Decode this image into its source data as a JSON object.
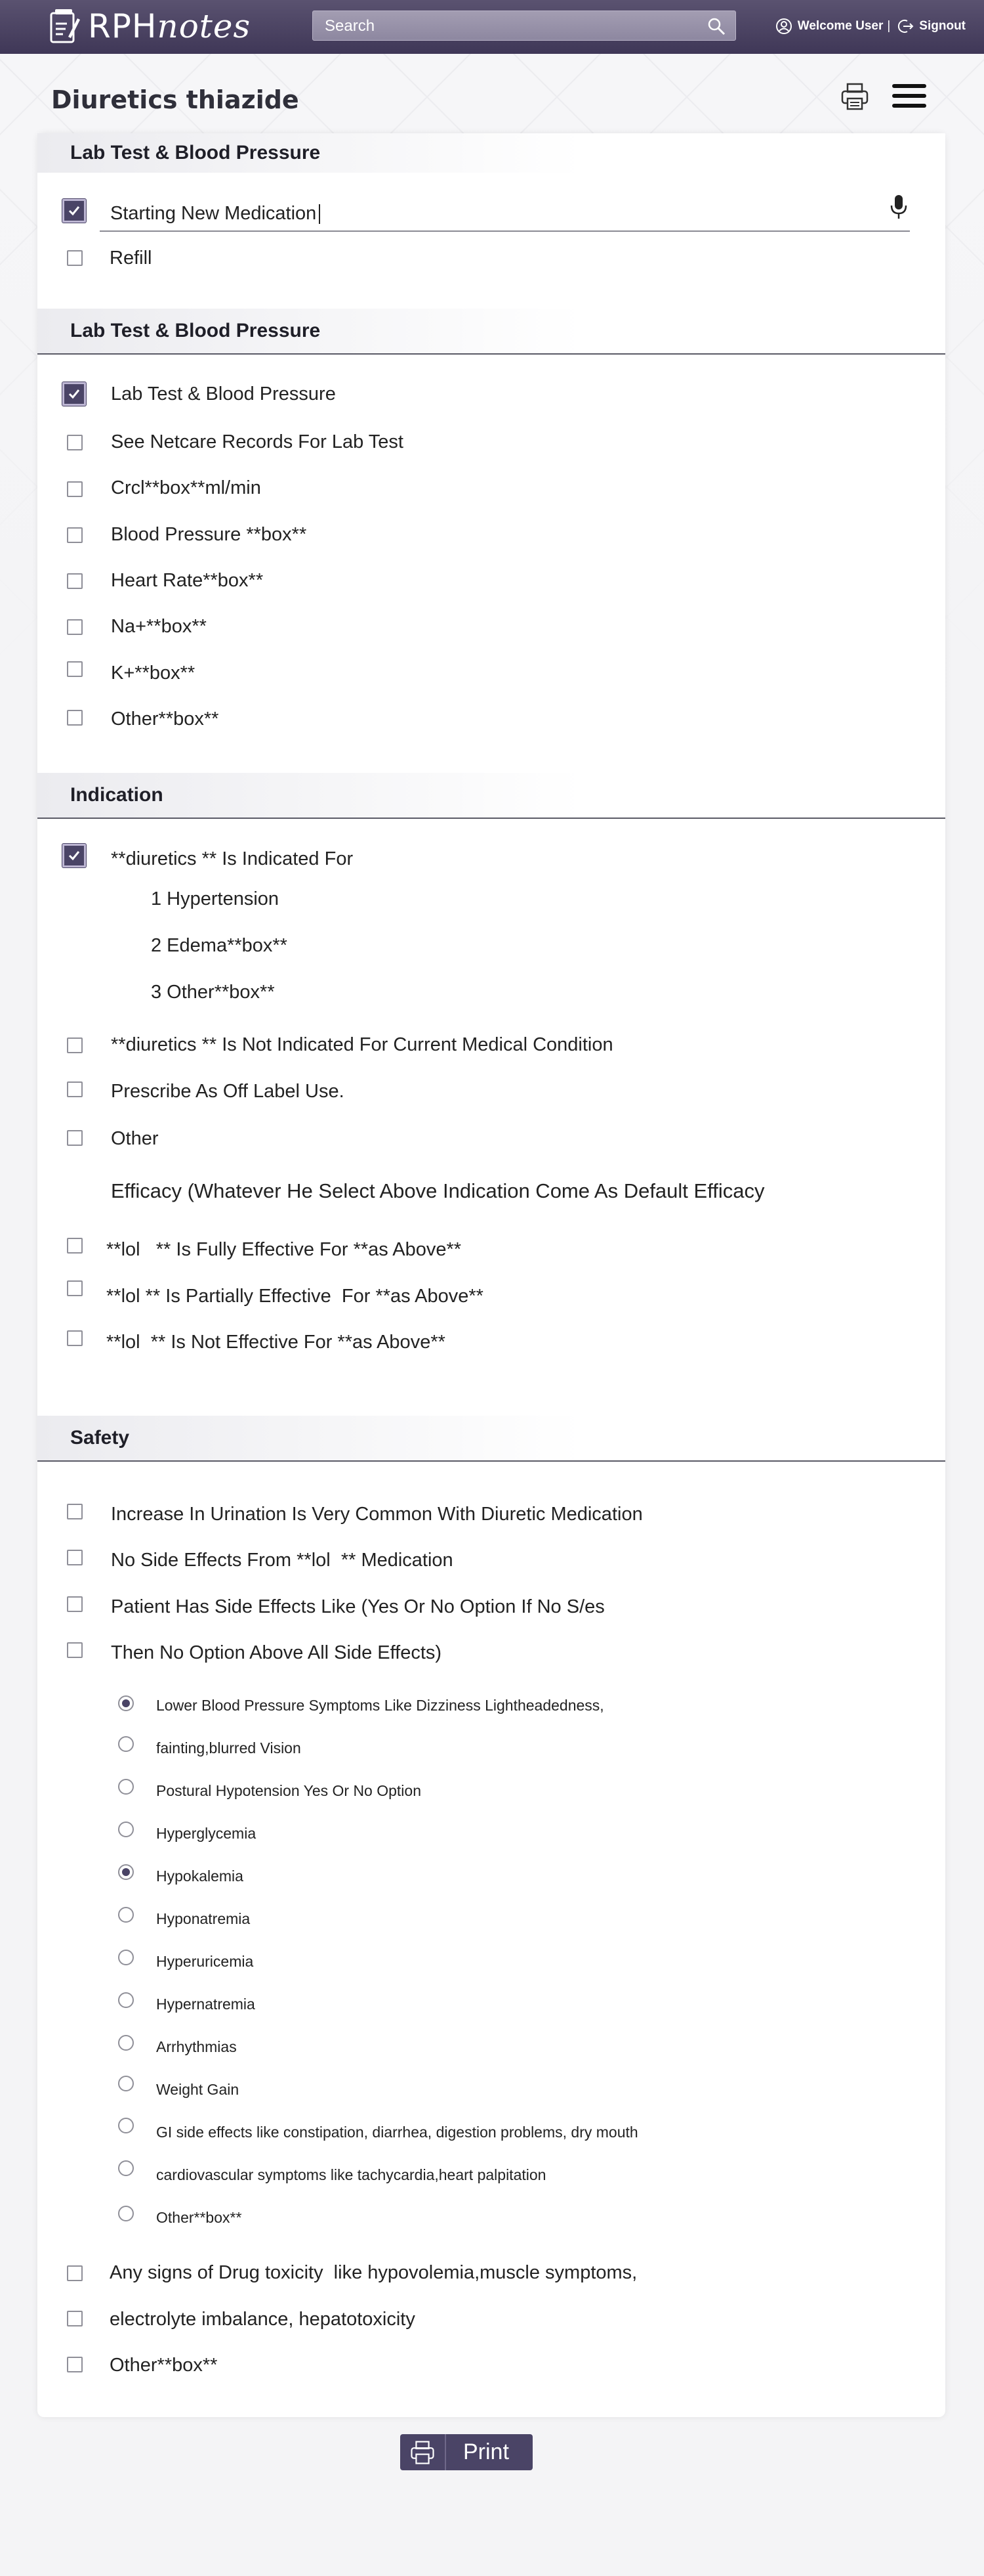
{
  "header": {
    "logo_text_a": "RPH",
    "logo_text_b": "notes",
    "search_placeholder": "Search",
    "user_label": "Welcome User",
    "separator": "|",
    "signout_label": "Signout"
  },
  "page": {
    "title": "Diuretics thiazide"
  },
  "section1": {
    "heading": "Lab Test & Blood Pressure",
    "input_value": "Starting New Medication",
    "refill_label": "Refill"
  },
  "section2": {
    "heading": "Lab Test & Blood Pressure",
    "items": [
      "Lab Test & Blood Pressure",
      "See Netcare Records For Lab Test",
      "Crcl**box**ml/min",
      "Blood Pressure **box**",
      "Heart Rate**box**",
      "Na+**box**",
      "K+**box**",
      "Other**box**"
    ]
  },
  "section3": {
    "heading": "Indication",
    "indicated_for": "**diuretics ** Is Indicated For",
    "sub_items": [
      "1 Hypertension",
      "2 Edema**box**",
      "3 Other**box**"
    ],
    "not_indicated": "**diuretics ** Is Not Indicated For Current Medical Condition",
    "off_label": "Prescribe As Off Label Use.",
    "other": "Other",
    "efficacy_note": "Efficacy (Whatever He Select Above Indication Come As Default Efficacy",
    "efficacy_items": [
      "**lol   ** Is Fully Effective For **as Above**",
      "**lol ** Is Partially Effective  For **as Above**",
      "**lol  ** Is Not Effective For **as Above**"
    ]
  },
  "section4": {
    "heading": "Safety",
    "items": [
      "Increase In Urination Is Very Common With Diuretic Medication",
      "No Side Effects From **lol  ** Medication",
      "Patient Has Side Effects Like (Yes Or No Option If No S/es",
      "Then No Option Above All Side Effects)"
    ],
    "radios": [
      "Lower Blood Pressure Symptoms Like Dizziness Lightheadedness,",
      "fainting,blurred Vision",
      "Postural Hypotension Yes Or No Option",
      "Hyperglycemia",
      "Hypokalemia",
      "Hyponatremia",
      "Hyperuricemia",
      "Hypernatremia",
      "Arrhythmias",
      "Weight Gain",
      "GI side effects like constipation, diarrhea, digestion problems, dry mouth",
      "cardiovascular symptoms like tachycardia,heart palpitation",
      "Other**box**"
    ],
    "tail_items": [
      "Any signs of Drug toxicity  like hypovolemia,muscle symptoms,",
      "electrolyte imbalance, hepatotoxicity",
      "Other**box**"
    ]
  },
  "footer": {
    "print_label": "Print"
  }
}
